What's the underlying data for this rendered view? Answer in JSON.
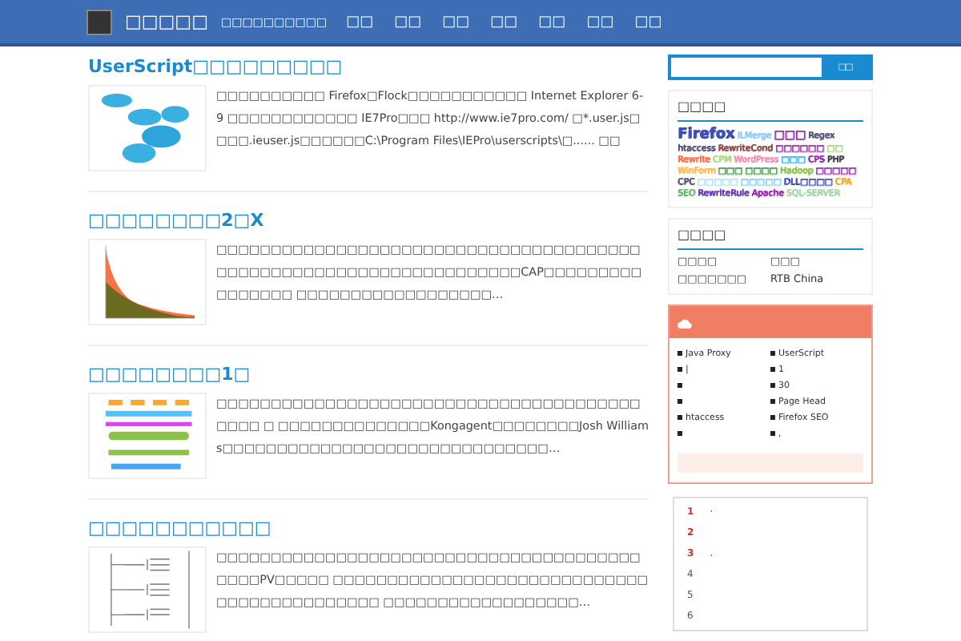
{
  "nav": {
    "site_title": "□□□□□",
    "subtitle": "□□□□□□□□□□",
    "menu": [
      "□□",
      "□□",
      "□□",
      "□□",
      "□□",
      "□□",
      "□□"
    ]
  },
  "posts": [
    {
      "kind": "blobs",
      "title": "UserScript□□□□□□□□□",
      "excerpt": "□□□□□□□□□□ Firefox□Flock□□□□□□□□□□□ Internet Explorer 6-9 □□□□□□□□□□□□ IE7Pro□□□ http://www.ie7pro.com/ □*.user.js□□□□.ieuser.js□□□□□□C:\\Program Files\\IEPro\\userscripts\\□...... □□"
    },
    {
      "kind": "chart",
      "title": "□□□□□□□□2□X",
      "excerpt": "□□□□□□□□□□□□□□□□□□□□□□□□□□□□□□□□□□□□□□□□□□□□□□□□□□□□□□□□□□□□□□□□□□□CAP□□□□□□□□□□□□□□□□ □□□□□□□□□□□□□□□□□□…"
    },
    {
      "kind": "diagram",
      "title": "□□□□□□□□1□",
      "excerpt": "□□□□□□□□□□□□□□□□□□□□□□□□□□□□□□□□□□□□□□□□□□□ □ □□□□□□□□□□□□□□Kongagent□□□□□□□□Josh Williams□□□□□□□□□□□□□□□□□□□□□□□□□□□□□□…"
    },
    {
      "kind": "tree",
      "title": "□□□□□□□□□□□",
      "excerpt": "□□□□□□□□□□□□□□□□□□□□□□□□□□□□□□□□□□□□□□□□□□□PV□□□□□ □□□□□□□□□□□□□□□□□□□□□□□□□□□□□□□□□□□□□□□□□□□□ □□□□□□□□□□□□□□□□□□…"
    }
  ],
  "search": {
    "button": "□□"
  },
  "tag_cloud": {
    "title": "□□□□",
    "tags": [
      {
        "text": "Firefox",
        "color": "#3f51b5",
        "kind": "large"
      },
      {
        "text": "ILMerge",
        "color": "#90caf9",
        "kind": "small"
      },
      {
        "text": "□□□",
        "color": "#9c27b0",
        "kind": "medium"
      },
      {
        "text": "Regex",
        "color": "#555577",
        "kind": "small"
      },
      {
        "text": "htaccess",
        "color": "#555577",
        "kind": "small"
      },
      {
        "text": "RewriteCond",
        "color": "#8d4b4b",
        "kind": "small"
      },
      {
        "text": "□□□□□□",
        "color": "#9c27b0",
        "kind": "small"
      },
      {
        "text": "□□",
        "color": "#aed581",
        "kind": "small"
      },
      {
        "text": "Rewrite",
        "color": "#ff7043",
        "kind": "small"
      },
      {
        "text": "CPM",
        "color": "#aed581",
        "kind": "small"
      },
      {
        "text": "WordPress",
        "color": "#f48fb1",
        "kind": "small"
      },
      {
        "text": "□□□",
        "color": "#29b6f6",
        "kind": "small"
      },
      {
        "text": "CPS",
        "color": "#9c27b0",
        "kind": "small"
      },
      {
        "text": "PHP",
        "color": "#444444",
        "kind": "small"
      },
      {
        "text": "WinForm",
        "color": "#ffb74d",
        "kind": "small"
      },
      {
        "text": "□□□",
        "color": "#43a047",
        "kind": "small"
      },
      {
        "text": "□□□□",
        "color": "#43a047",
        "kind": "small"
      },
      {
        "text": "Hadoop",
        "color": "#8bc34a",
        "kind": "small"
      },
      {
        "text": "□□□□□",
        "color": "#9c27b0",
        "kind": "small"
      },
      {
        "text": "CPC",
        "color": "#555577",
        "kind": "small"
      },
      {
        "text": "□□□□□",
        "color": "#b3e5fc",
        "kind": "small"
      },
      {
        "text": "□□□□□",
        "color": "#81d4fa",
        "kind": "small"
      },
      {
        "text": "DLL□□□□",
        "color": "#3f51b5",
        "kind": "small"
      },
      {
        "text": "CPA",
        "color": "#ffa726",
        "kind": "small"
      },
      {
        "text": "SEO",
        "color": "#66bb6a",
        "kind": "small"
      },
      {
        "text": "RewriteRule",
        "color": "#673ab7",
        "kind": "small"
      },
      {
        "text": "Apache",
        "color": "#9c27b0",
        "kind": "small"
      },
      {
        "text": "SQL-SERVER",
        "color": "#a5d6a7",
        "kind": "small"
      }
    ]
  },
  "links": {
    "title": "□□□□",
    "items": [
      "□□□□",
      "□□□",
      "□□□□□□□",
      "RTB China"
    ]
  },
  "recent": {
    "items": [
      {
        "kind": "text",
        "text": "Java Proxy"
      },
      {
        "kind": "text",
        "text": "UserScript"
      },
      {
        "kind": "text",
        "text": "|"
      },
      {
        "kind": "text",
        "text": "1"
      },
      {
        "kind": "blank"
      },
      {
        "kind": "text",
        "text": "30"
      },
      {
        "kind": "blank"
      },
      {
        "kind": "text",
        "text": "Page  Head"
      },
      {
        "kind": "text",
        "text": "htaccess"
      },
      {
        "kind": "text",
        "text": "Firefox SEO"
      },
      {
        "kind": "blank"
      },
      {
        "kind": "text",
        "text": ","
      }
    ]
  },
  "ranking": [
    {
      "number": "1",
      "hot": true,
      "text": "·"
    },
    {
      "number": "2",
      "hot": true
    },
    {
      "number": "3",
      "hot": true,
      "text": "."
    },
    {
      "number": "4",
      "hot": false
    },
    {
      "number": "5",
      "hot": false
    },
    {
      "number": "6",
      "hot": false
    }
  ]
}
